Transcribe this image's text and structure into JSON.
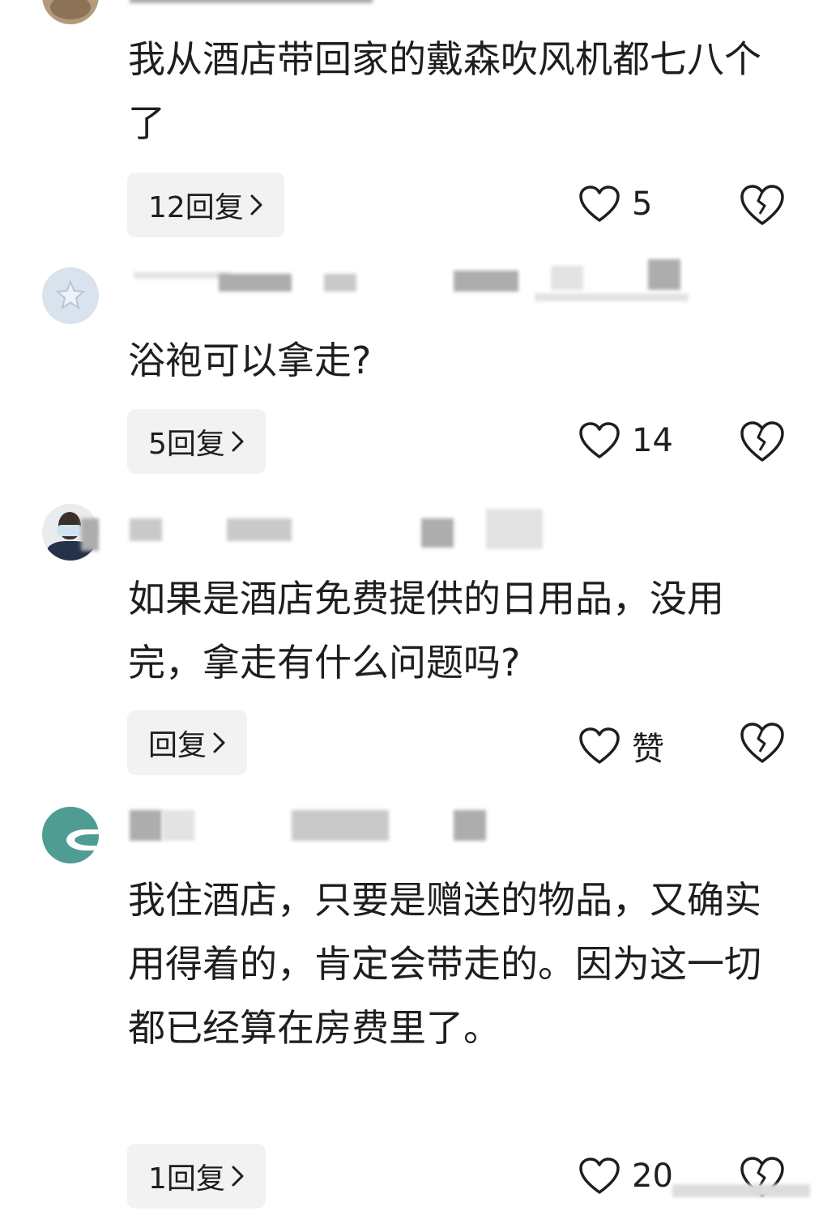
{
  "comments": [
    {
      "text": "我从酒店带回家的戴森吹风机都七八个了",
      "reply_label": "12回复",
      "like_count": "5"
    },
    {
      "text": "浴袍可以拿走?",
      "reply_label": "5回复",
      "like_count": "14"
    },
    {
      "text": "如果是酒店免费提供的日用品，没用完，拿走有什么问题吗?",
      "reply_label": "回复",
      "like_count": "赞"
    },
    {
      "text": "我住酒店，只要是赠送的物品，又确实用得着的，肯定会带走的。因为这一切都已经算在房费里了。",
      "reply_label": "1回复",
      "like_count": "20"
    }
  ],
  "icons": {
    "like": "heart-outline-icon",
    "dislike": "broken-heart-icon",
    "reply_arrow": "chevron-right-icon"
  },
  "colors": {
    "reply_button_bg": "#f2f2f2",
    "text": "#1e1e1e"
  }
}
